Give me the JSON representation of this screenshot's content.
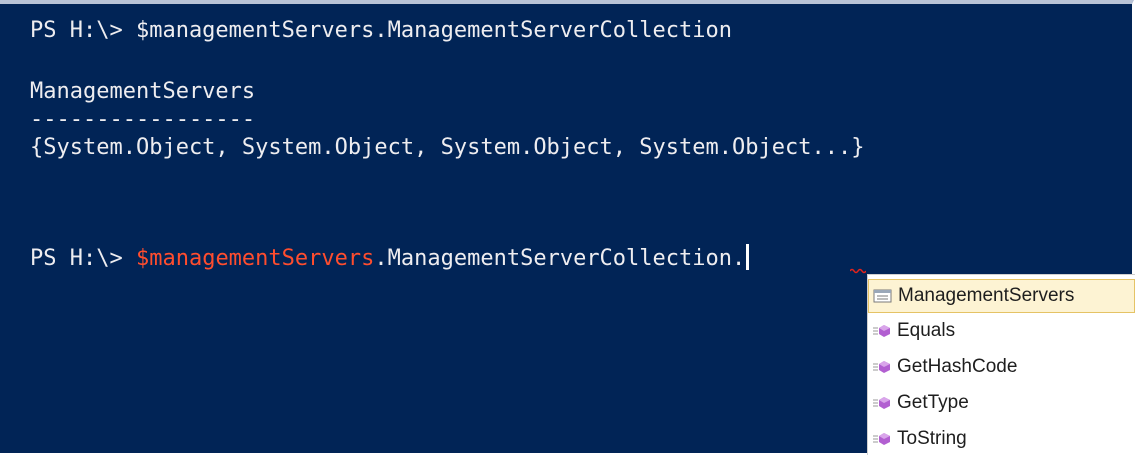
{
  "console": {
    "line1": "PS H:\\> $managementServers.ManagementServerCollection",
    "header": "ManagementServers",
    "separator": "-----------------",
    "result": "{System.Object, System.Object, System.Object, System.Object...}",
    "prompt": "PS H:\\> ",
    "variable": "$managementServers",
    "member_access": ".ManagementServerCollection."
  },
  "colors": {
    "background": "#012456",
    "text": "#eeedf0",
    "variable": "#ff4d2e",
    "selection": "#fdf3d3"
  },
  "intellisense": {
    "items": [
      {
        "label": "ManagementServers",
        "icon": "property-icon",
        "selected": true
      },
      {
        "label": "Equals",
        "icon": "method-icon",
        "selected": false
      },
      {
        "label": "GetHashCode",
        "icon": "method-icon",
        "selected": false
      },
      {
        "label": "GetType",
        "icon": "method-icon",
        "selected": false
      },
      {
        "label": "ToString",
        "icon": "method-icon",
        "selected": false
      }
    ]
  }
}
